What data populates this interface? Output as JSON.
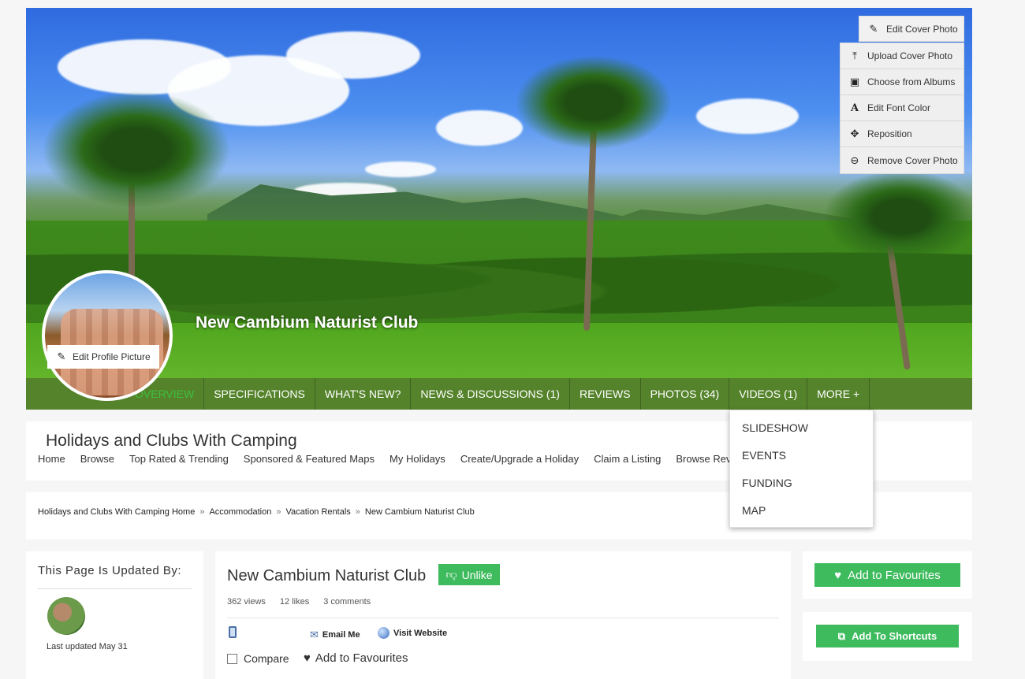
{
  "cover": {
    "title": "New Cambium Naturist Club",
    "edit_cover_label": "Edit Cover Photo",
    "menu": [
      {
        "icon": "upload-icon",
        "label": "Upload Cover Photo"
      },
      {
        "icon": "image-icon",
        "label": "Choose from Albums"
      },
      {
        "icon": "font-icon",
        "label": "Edit Font Color"
      },
      {
        "icon": "move-icon",
        "label": "Reposition"
      },
      {
        "icon": "minus-circle-icon",
        "label": "Remove Cover Photo"
      }
    ],
    "edit_profile_label": "Edit Profile Picture"
  },
  "nav": {
    "items": [
      "OVERVIEW",
      "SPECIFICATIONS",
      "WHAT'S NEW?",
      "NEWS & DISCUSSIONS (1)",
      "REVIEWS",
      "PHOTOS (34)",
      "VIDEOS (1)",
      "MORE +"
    ],
    "more_menu": [
      "SLIDESHOW",
      "EVENTS",
      "FUNDING",
      "MAP"
    ]
  },
  "site": {
    "title": "Holidays and Clubs With Camping",
    "links": [
      "Home",
      "Browse",
      "Top Rated & Trending",
      "Sponsored & Featured Maps",
      "My Holidays",
      "Create/Upgrade a Holiday",
      "Claim a Listing",
      "Browse Rev"
    ]
  },
  "breadcrumb": [
    "Holidays and Clubs With Camping Home",
    "Accommodation",
    "Vacation Rentals",
    "New Cambium Naturist Club"
  ],
  "sidebar": {
    "updated_by_label": "This Page Is Updated By:",
    "last_updated": "Last updated May 31"
  },
  "listing": {
    "name": "New Cambium Naturist Club",
    "unlike_label": "Unlike",
    "views": "362 views",
    "likes": "12 likes",
    "comments": "3 comments",
    "email_label": "Email Me",
    "website_label": "Visit Website",
    "compare_label": "Compare",
    "favourites_label": "Add to Favourites"
  },
  "actions": {
    "add_favourites": "Add to Favourites",
    "add_shortcuts": "Add To Shortcuts"
  },
  "colors": {
    "accent_green": "#3dbb5d",
    "nav_bg": "#46781a"
  }
}
